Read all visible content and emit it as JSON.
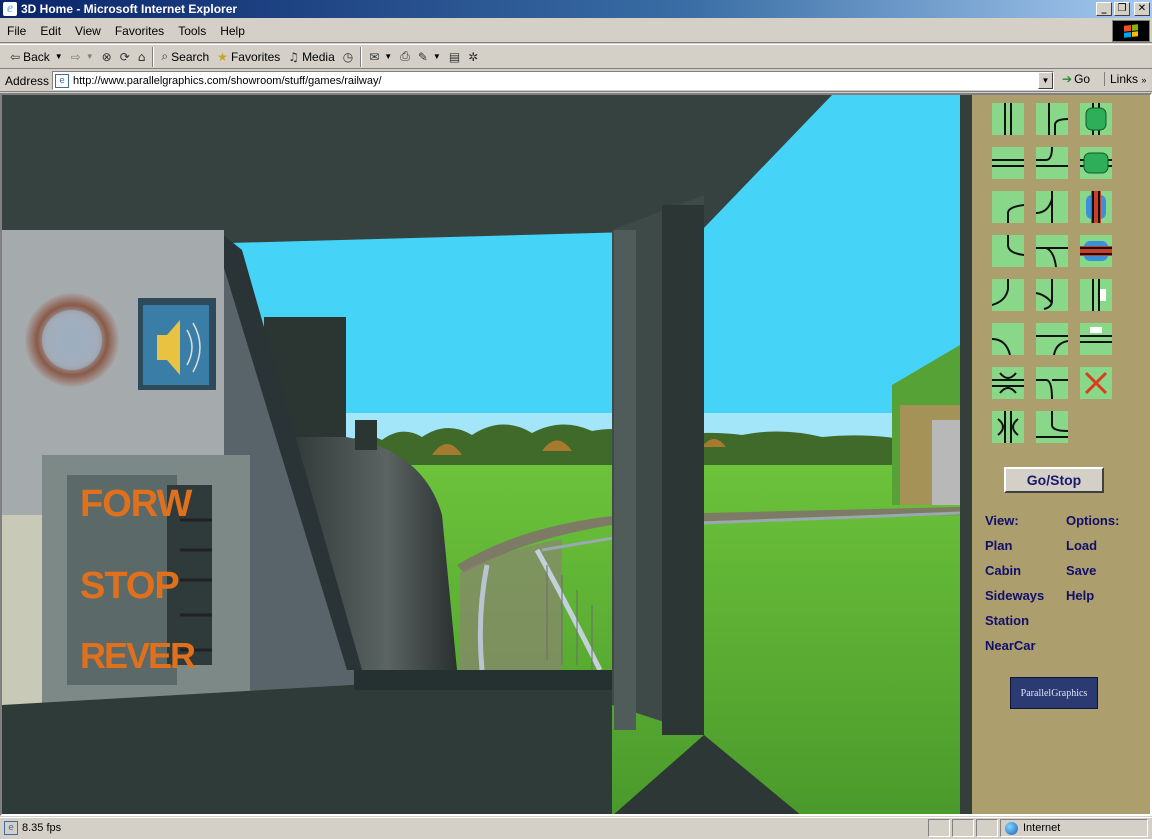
{
  "window": {
    "title": "3D Home - Microsoft Internet Explorer",
    "controls": [
      "_",
      "❐",
      "✕"
    ]
  },
  "menu": [
    "File",
    "Edit",
    "View",
    "Favorites",
    "Tools",
    "Help"
  ],
  "toolbar": {
    "back_label": "Back",
    "search_label": "Search",
    "favorites_label": "Favorites",
    "media_label": "Media"
  },
  "address": {
    "label": "Address",
    "url": "http://www.parallelgraphics.com/showroom/stuff/games/railway/",
    "go_label": "Go",
    "links_label": "Links"
  },
  "scene": {
    "lever_labels": [
      "FORW",
      "STOP",
      "REVER"
    ],
    "sound_icon": "speaker-icon"
  },
  "panel": {
    "tiles": [
      "straight-vertical",
      "curve-branch-right",
      "station-green-vertical",
      "straight-horizontal",
      "curve-branch-down",
      "station-green-horizontal",
      "curve-top-left",
      "switch-right-up",
      "crossing-red-vertical",
      "curve-bottom-left",
      "switch-left-down",
      "crossing-red-horizontal",
      "curve-small-left",
      "curve-small-right",
      "signal-vertical",
      "curve-small-down",
      "switch-t-right",
      "signal-horizontal",
      "bridge-horizontal",
      "switch-up-right",
      "delete-x",
      "bridge-vertical",
      "curve-bottom-right"
    ],
    "go_stop_label": "Go/Stop",
    "view_header": "View:",
    "view_links": [
      "Plan",
      "Cabin",
      "Sideways",
      "Station",
      "NearCar"
    ],
    "options_header": "Options:",
    "options_links": [
      "Load",
      "Save",
      "Help"
    ],
    "logo_text": "ParallelGraphics"
  },
  "status": {
    "text": "8.35 fps",
    "zone": "Internet"
  },
  "colors": {
    "sky": "#45d3f7",
    "grass": "#5aae34",
    "panel_bg": "#ad9e6e",
    "tile_bg": "#89d889",
    "link_color": "#10106a",
    "lever_text": "#e0701c"
  }
}
